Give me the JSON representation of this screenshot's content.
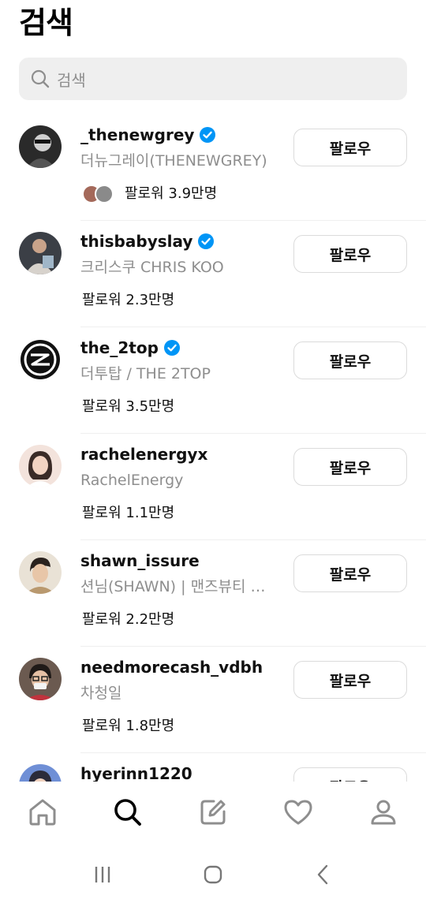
{
  "header": {
    "title": "검색"
  },
  "search": {
    "placeholder": "검색",
    "icon": "search-icon"
  },
  "results": [
    {
      "username": "_thenewgrey",
      "verified": true,
      "full_name": "더뉴그레이(THENEWGREY)",
      "followers": "팔로워 3.9만명",
      "has_mutuals": true,
      "button": "팔로우",
      "avatar_color": "#2a2a2a"
    },
    {
      "username": "thisbabyslay",
      "verified": true,
      "full_name": "크리스쿠 CHRIS KOO",
      "followers": "팔로워 2.3만명",
      "has_mutuals": false,
      "button": "팔로우",
      "avatar_color": "#3b3f46"
    },
    {
      "username": "the_2top",
      "verified": true,
      "full_name": "더투탑 / THE 2TOP",
      "followers": "팔로워 3.5만명",
      "has_mutuals": false,
      "button": "팔로우",
      "avatar_color": "#111111"
    },
    {
      "username": "rachelenergyx",
      "verified": false,
      "full_name": "RachelEnergy",
      "followers": "팔로워 1.1만명",
      "has_mutuals": false,
      "button": "팔로우",
      "avatar_color": "#f3e3dc"
    },
    {
      "username": "shawn_issure",
      "verified": false,
      "full_name": "션님(SHAWN) | 맨즈뷰티 크리에이터",
      "followers": "팔로워 2.2만명",
      "has_mutuals": false,
      "button": "팔로우",
      "avatar_color": "#d9cbb8"
    },
    {
      "username": "needmorecash_vdbh",
      "verified": false,
      "full_name": "차청일",
      "followers": "팔로워 1.8만명",
      "has_mutuals": false,
      "button": "팔로우",
      "avatar_color": "#6b5a50"
    },
    {
      "username": "hyerinn1220",
      "verified": false,
      "full_name": "",
      "followers": "",
      "has_mutuals": false,
      "button": "팔로우",
      "avatar_color": "#6f8fd6"
    }
  ],
  "bottom_nav": [
    "home-icon",
    "search-icon",
    "compose-icon",
    "heart-icon",
    "profile-icon"
  ],
  "system_nav": [
    "recent-apps-icon",
    "home-button-icon",
    "back-icon"
  ],
  "colors": {
    "verified": "#0095f6",
    "secondary_text": "#8e8e8e",
    "search_bg": "#efefef",
    "border": "#dbdbdb"
  }
}
